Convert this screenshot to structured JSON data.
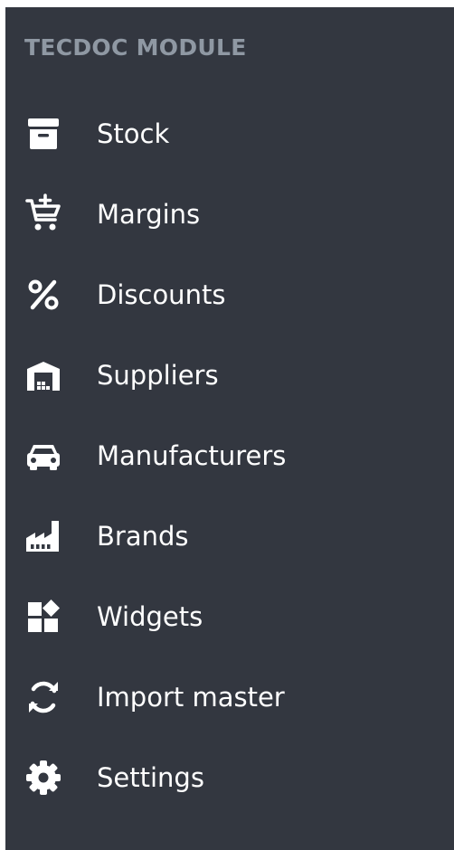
{
  "sidebar": {
    "section_title": "TECDOC MODULE",
    "background_color": "#333740",
    "title_color": "#8f98a3",
    "text_color": "#ffffff",
    "items": [
      {
        "label": "Stock",
        "icon": "archive-box-icon"
      },
      {
        "label": "Margins",
        "icon": "cart-plus-icon"
      },
      {
        "label": "Discounts",
        "icon": "percent-icon"
      },
      {
        "label": "Suppliers",
        "icon": "warehouse-icon"
      },
      {
        "label": "Manufacturers",
        "icon": "car-icon"
      },
      {
        "label": "Brands",
        "icon": "factory-icon"
      },
      {
        "label": "Widgets",
        "icon": "widgets-icon"
      },
      {
        "label": "Import master",
        "icon": "sync-icon"
      },
      {
        "label": "Settings",
        "icon": "gear-icon"
      }
    ]
  }
}
